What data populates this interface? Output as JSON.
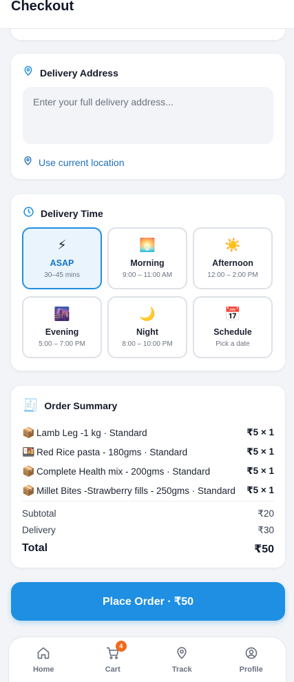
{
  "header": {
    "title": "Checkout"
  },
  "address": {
    "title": "Delivery Address",
    "placeholder": "Enter your full delivery address...",
    "value": "",
    "use_location": "Use current location"
  },
  "delivery_time": {
    "title": "Delivery Time",
    "selected": "ASAP",
    "slots": [
      {
        "icon": "⚡",
        "name": "ASAP",
        "time": "30–45 mins"
      },
      {
        "icon": "🌅",
        "name": "Morning",
        "time": "9:00 – 11:00 AM"
      },
      {
        "icon": "☀️",
        "name": "Afternoon",
        "time": "12:00 – 2:00 PM"
      },
      {
        "icon": "🌆",
        "name": "Evening",
        "time": "5:00 – 7:00 PM"
      },
      {
        "icon": "🌙",
        "name": "Night",
        "time": "8:00 – 10:00 PM"
      },
      {
        "icon": "📅",
        "name": "Schedule",
        "time": "Pick a date"
      }
    ]
  },
  "summary": {
    "icon": "🧾",
    "title": "Order Summary",
    "items": [
      {
        "icon": "📦",
        "name": "Lamb Leg -1 kg · Standard",
        "price": "₹5 × 1"
      },
      {
        "icon": "🍱",
        "name": "Red Rice pasta - 180gms · Standard",
        "price": "₹5 × 1"
      },
      {
        "icon": "📦",
        "name": "Complete Health mix - 200gms · Standard",
        "price": "₹5 × 1"
      },
      {
        "icon": "📦",
        "name": "Millet Bites -Strawberry fills - 250gms · Standard",
        "price": "₹5 × 1"
      }
    ],
    "subtotal_label": "Subtotal",
    "subtotal": "₹20",
    "delivery_label": "Delivery",
    "delivery": "₹30",
    "total_label": "Total",
    "total": "₹50"
  },
  "place_order": "Place Order · ₹50",
  "nav": {
    "items": [
      {
        "label": "Home",
        "icon": "home-icon"
      },
      {
        "label": "Cart",
        "icon": "cart-icon",
        "badge": "4"
      },
      {
        "label": "Track",
        "icon": "map-pin-icon"
      },
      {
        "label": "Profile",
        "icon": "user-circle-icon"
      }
    ]
  },
  "colors": {
    "accent": "#1e8fe3",
    "link": "#1f6fb8",
    "selected_bg": "#eaf4fd",
    "badge": "#f06a1d",
    "background": "#f2f4f7"
  }
}
